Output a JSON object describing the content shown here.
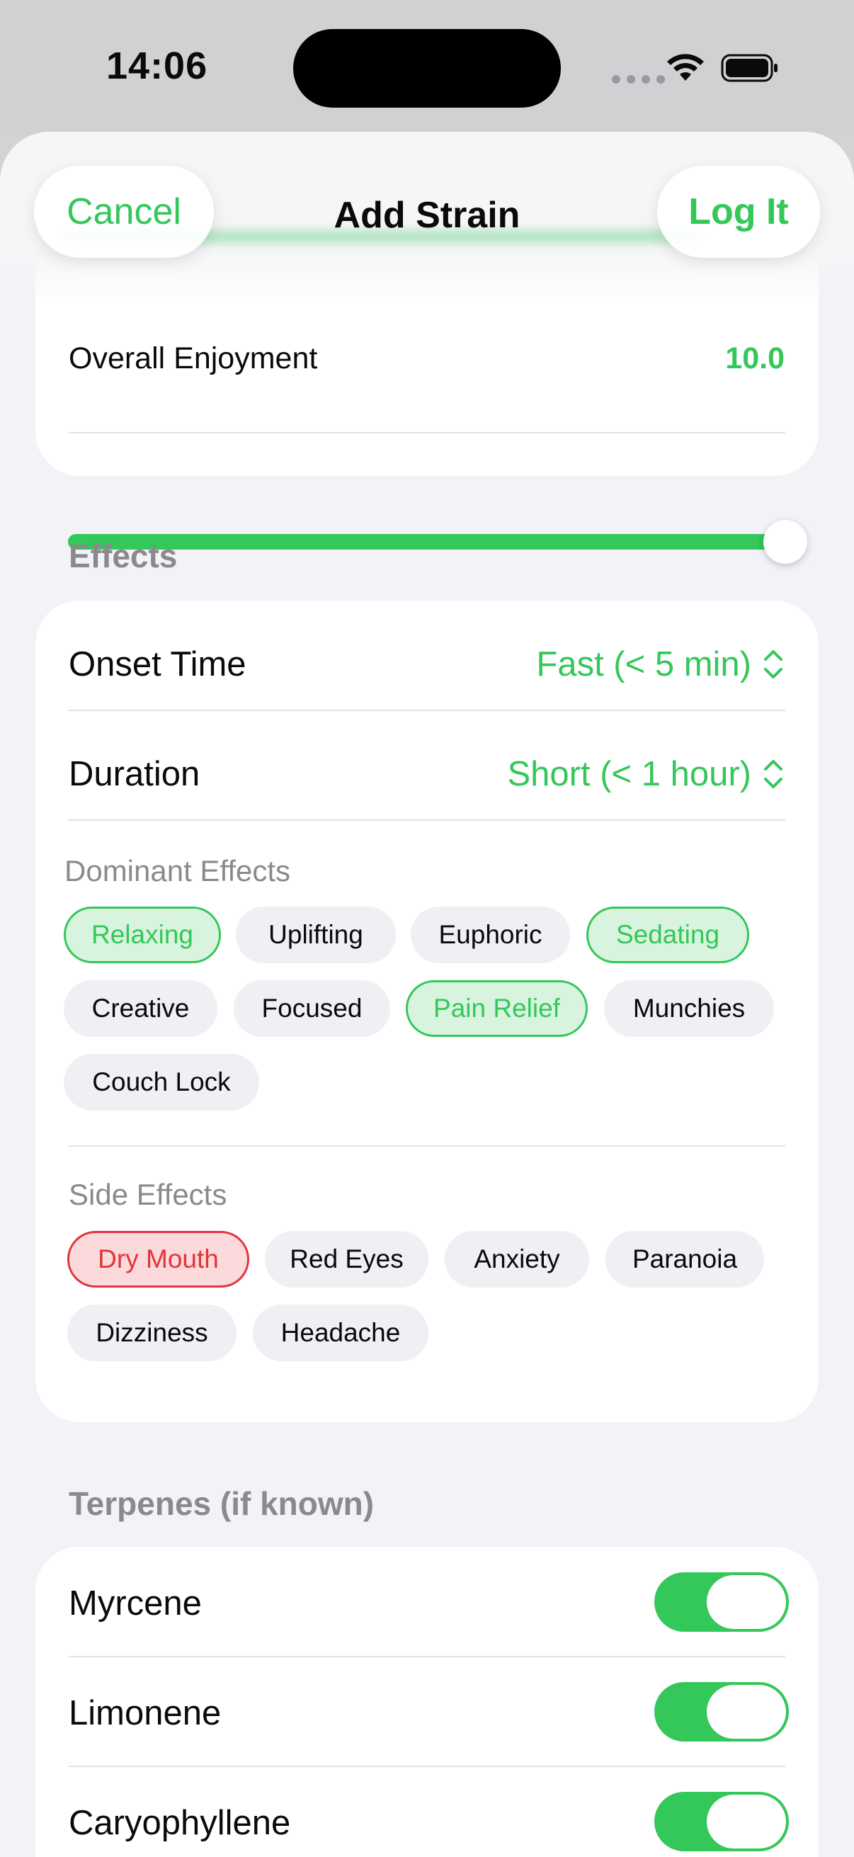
{
  "status": {
    "time": "14:06"
  },
  "nav": {
    "cancel_label": "Cancel",
    "title": "Add Strain",
    "log_label": "Log It"
  },
  "enjoyment": {
    "label": "Overall Enjoyment",
    "value": "10.0",
    "slider_fraction": 1.0
  },
  "effects": {
    "header": "Effects",
    "onset": {
      "label": "Onset Time",
      "value": "Fast (< 5 min)"
    },
    "duration": {
      "label": "Duration",
      "value": "Short (< 1 hour)"
    },
    "dominant": {
      "label": "Dominant Effects",
      "chips": [
        {
          "label": "Relaxing",
          "selected": true
        },
        {
          "label": "Uplifting",
          "selected": false
        },
        {
          "label": "Euphoric",
          "selected": false
        },
        {
          "label": "Sedating",
          "selected": true
        },
        {
          "label": "Creative",
          "selected": false
        },
        {
          "label": "Focused",
          "selected": false
        },
        {
          "label": "Pain Relief",
          "selected": true
        },
        {
          "label": "Munchies",
          "selected": false
        },
        {
          "label": "Couch Lock",
          "selected": false
        }
      ]
    },
    "side": {
      "label": "Side Effects",
      "chips": [
        {
          "label": "Dry Mouth",
          "selected": true
        },
        {
          "label": "Red Eyes",
          "selected": false
        },
        {
          "label": "Anxiety",
          "selected": false
        },
        {
          "label": "Paranoia",
          "selected": false
        },
        {
          "label": "Dizziness",
          "selected": false
        },
        {
          "label": "Headache",
          "selected": false
        }
      ]
    }
  },
  "terpenes": {
    "header": "Terpenes (if known)",
    "items": [
      {
        "label": "Myrcene",
        "on": true
      },
      {
        "label": "Limonene",
        "on": true
      },
      {
        "label": "Caryophyllene",
        "on": true
      }
    ]
  },
  "colors": {
    "accent": "#34c759",
    "danger": "#e0353b",
    "background": "#f2f2f7"
  }
}
